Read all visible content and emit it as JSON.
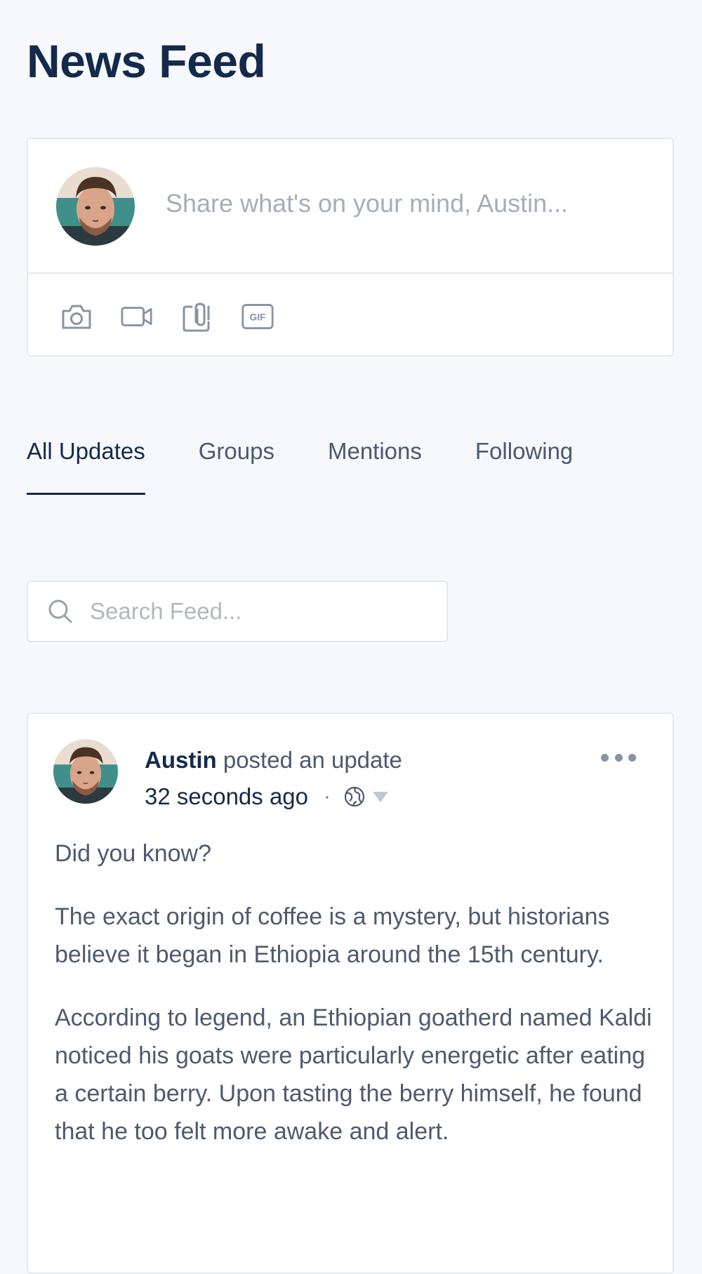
{
  "page": {
    "title": "News Feed"
  },
  "composer": {
    "placeholder": "Share what's on your mind, Austin...",
    "tools": [
      "camera-icon",
      "video-icon",
      "attachment-icon",
      "gif-icon"
    ]
  },
  "tabs": [
    {
      "label": "All Updates",
      "active": true
    },
    {
      "label": "Groups",
      "active": false
    },
    {
      "label": "Mentions",
      "active": false
    },
    {
      "label": "Following",
      "active": false
    }
  ],
  "search": {
    "placeholder": "Search Feed..."
  },
  "post": {
    "author": "Austin",
    "action": " posted an update",
    "time": "32 seconds ago",
    "separator": "·",
    "paragraphs": [
      "Did you know?",
      "The exact origin of coffee is a mystery, but historians believe it began in Ethiopia around the 15th century.",
      "According to legend, an Ethiopian goatherd named Kaldi noticed his goats were particularly energetic after eating a certain berry. Upon tasting the berry himself, he found that he too felt more awake and alert."
    ]
  },
  "colors": {
    "background": "#f6f8fb",
    "heading": "#142a4b",
    "muted": "#a7adb6",
    "border": "#e4e8ee"
  }
}
